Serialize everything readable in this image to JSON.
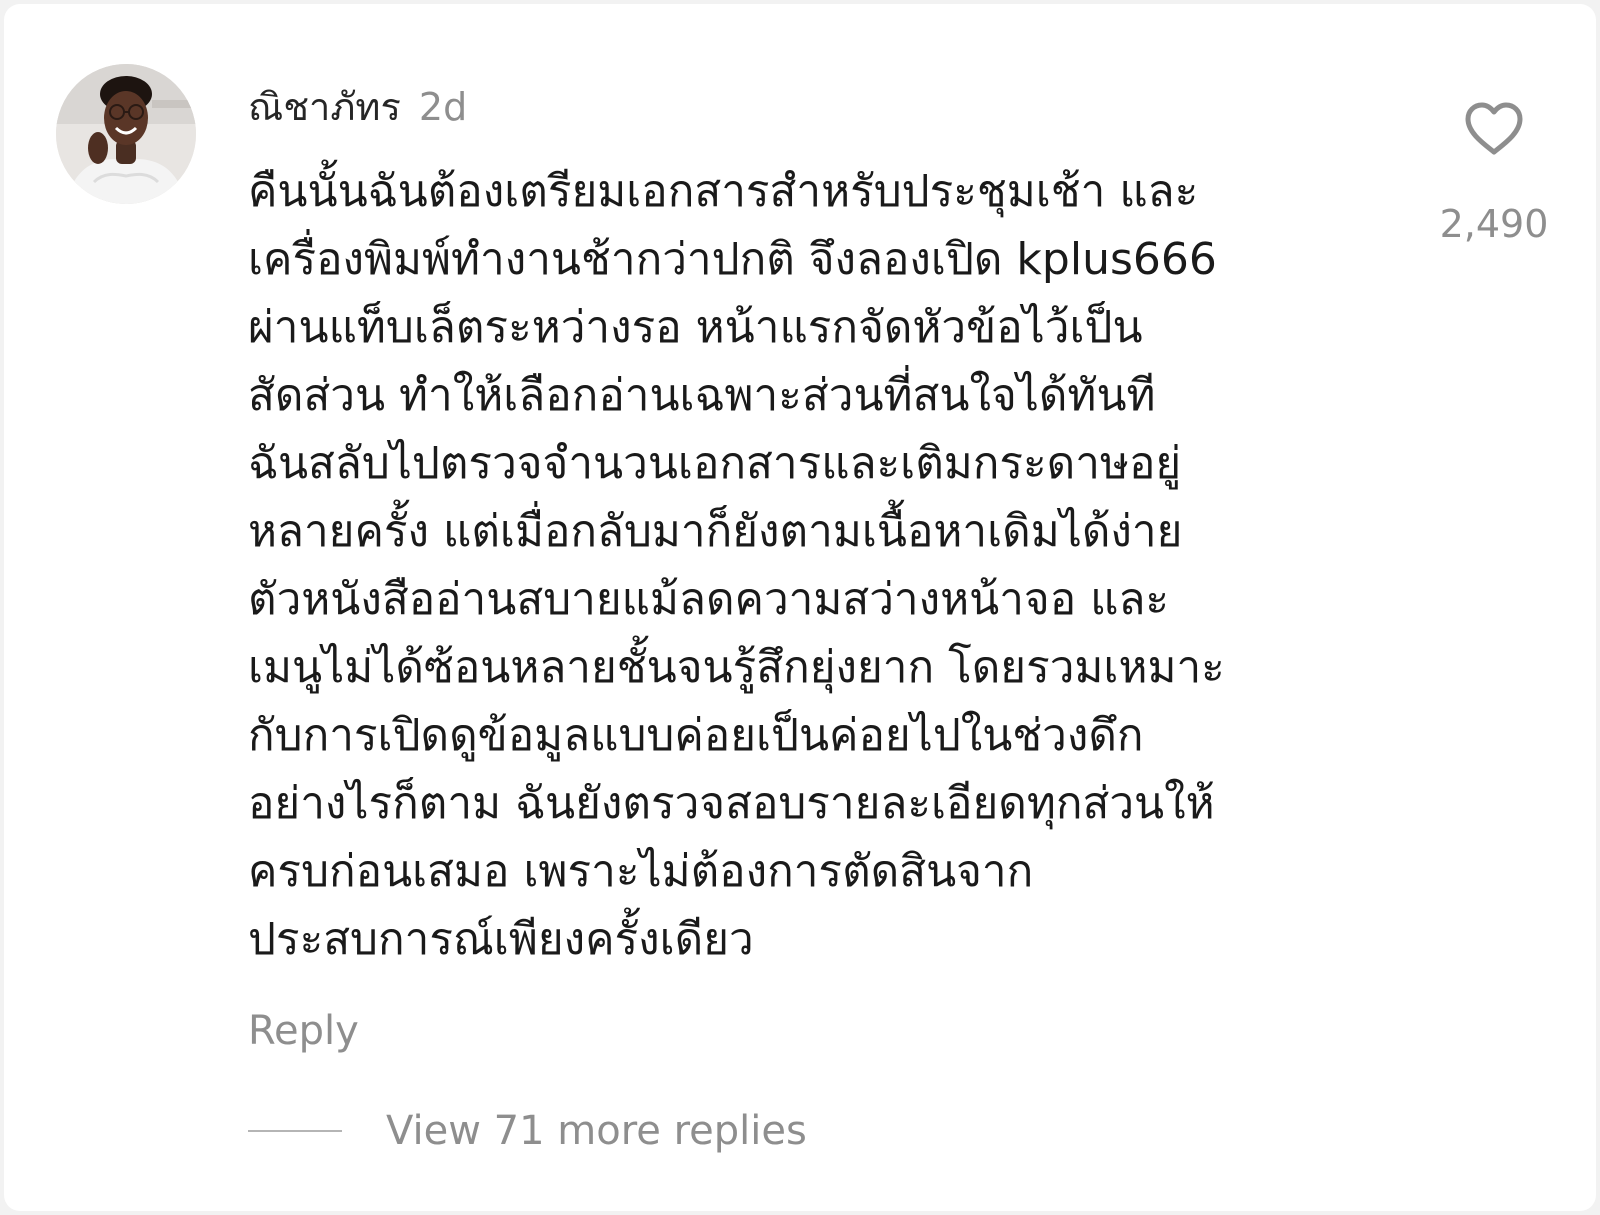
{
  "comment": {
    "avatar_icon": "user-avatar-photo",
    "username": "ณิชาภัทร",
    "timestamp": "2d",
    "text": "คืนนั้นฉันต้องเตรียมเอกสารสำหรับประชุมเช้า และ\nเครื่องพิมพ์ทำงานช้ากว่าปกติ จึงลองเปิด kplus666\nผ่านแท็บเล็ตระหว่างรอ หน้าแรกจัดหัวข้อไว้เป็น\nสัดส่วน ทำให้เลือกอ่านเฉพาะส่วนที่สนใจได้ทันที\nฉันสลับไปตรวจจำนวนเอกสารและเติมกระดาษอยู่\nหลายครั้ง แต่เมื่อกลับมาก็ยังตามเนื้อหาเดิมได้ง่าย\nตัวหนังสืออ่านสบายแม้ลดความสว่างหน้าจอ และ\nเมนูไม่ได้ซ้อนหลายชั้นจนรู้สึกยุ่งยาก โดยรวมเหมาะ\nกับการเปิดดูข้อมูลแบบค่อยเป็นค่อยไปในช่วงดึก\nอย่างไรก็ตาม ฉันยังตรวจสอบรายละเอียดทุกส่วนให้\nครบก่อนเสมอ เพราะไม่ต้องการตัดสินจาก\nประสบการณ์เพียงครั้งเดียว",
    "like_icon": "heart-outline-icon",
    "like_count": "2,490",
    "reply_label": "Reply",
    "view_replies_label": "View 71 more replies"
  },
  "colors": {
    "text_primary": "#1a1a1a",
    "text_secondary": "#8e8e8e",
    "background": "#ffffff"
  }
}
